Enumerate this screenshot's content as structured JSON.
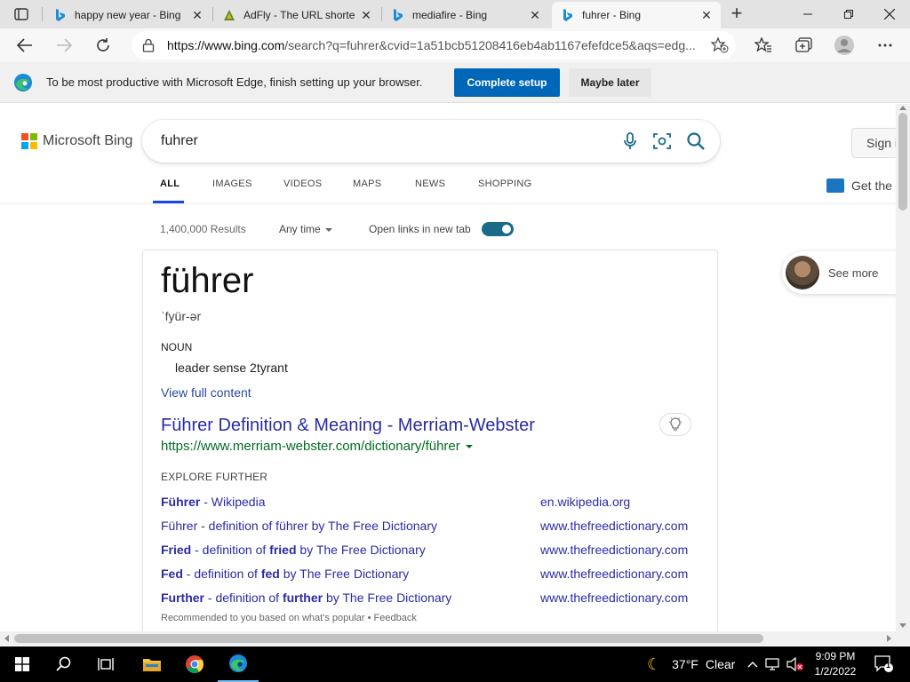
{
  "browser": {
    "tabs": [
      {
        "title": "happy new year - Bing",
        "icon": "bing-icon",
        "active": false
      },
      {
        "title": "AdFly - The URL shorte",
        "icon": "adfly-icon",
        "active": false
      },
      {
        "title": "mediafire - Bing",
        "icon": "bing-icon",
        "active": false
      },
      {
        "title": "fuhrer - Bing",
        "icon": "bing-icon",
        "active": true
      }
    ],
    "address": {
      "host": "https://www.bing.com",
      "rest": "/search?q=fuhrer&cvid=1a51bcb51208416eb4ab1167efefdce5&aqs=edg..."
    }
  },
  "infobar": {
    "message": "To be most productive with Microsoft Edge, finish setting up your browser.",
    "primary_label": "Complete setup",
    "secondary_label": "Maybe later"
  },
  "bing": {
    "logo_text": "Microsoft Bing",
    "query": "fuhrer",
    "signin_label": "Sign i",
    "get_app_label": "Get the",
    "scopes": [
      "ALL",
      "IMAGES",
      "VIDEOS",
      "MAPS",
      "NEWS",
      "SHOPPING"
    ],
    "result_count": "1,400,000 Results",
    "time_filter": "Any time",
    "open_links_label": "Open links in new tab",
    "open_links_enabled": true
  },
  "dictionary": {
    "word": "führer",
    "pronunciation": "ˈfyür-ər",
    "part_of_speech": "NOUN",
    "definition": "leader sense 2tyrant",
    "view_full": "View full content"
  },
  "result": {
    "title": "Führer Definition & Meaning - Merriam-Webster",
    "url": "https://www.merriam-webster.com/dictionary/führer",
    "explore_heading": "EXPLORE FURTHER",
    "explore": [
      {
        "bold": "Führer",
        "text": " - Wikipedia",
        "bold2": "",
        "text2": "",
        "site": "en.wikipedia.org"
      },
      {
        "bold": "",
        "text": "Führer - definition of führer by The Free Dictionary",
        "bold2": "",
        "text2": "",
        "site": "www.thefreedictionary.com"
      },
      {
        "bold": "Fried",
        "text": " - definition of ",
        "bold2": "fried",
        "text2": " by The Free Dictionary",
        "site": "www.thefreedictionary.com"
      },
      {
        "bold": "Fed",
        "text": " - definition of ",
        "bold2": "fed",
        "text2": " by The Free Dictionary",
        "site": "www.thefreedictionary.com"
      },
      {
        "bold": "Further",
        "text": " - definition of ",
        "bold2": "further",
        "text2": " by The Free Dictionary",
        "site": "www.thefreedictionary.com"
      }
    ],
    "footer": "Recommended to you based on what's popular • Feedback"
  },
  "side": {
    "see_more": "See more"
  },
  "taskbar": {
    "weather_temp": "37°F",
    "weather_text": "Clear",
    "time": "9:09 PM",
    "date": "1/2/2022",
    "notifications": "1"
  }
}
